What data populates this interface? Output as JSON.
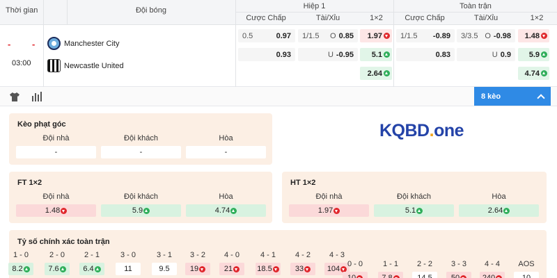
{
  "header": {
    "time": "Thời gian",
    "team": "Đội bóng",
    "half": "Hiệp 1",
    "full": "Toàn trận",
    "handicap": "Cược Chấp",
    "overunder": "Tài/Xỉu",
    "x12": "1×2"
  },
  "match": {
    "dash_left": "-",
    "dash_right": "-",
    "time": "03:00",
    "home": "Manchester City",
    "away": "Newcastle United",
    "half": {
      "hc_line": "0.5",
      "hc_home": "0.97",
      "hc_away": "0.93",
      "ou_line": "1/1.5",
      "ou_o_label": "O",
      "ou_o": "0.85",
      "ou_u_label": "U",
      "ou_u": "-0.95",
      "x12_home": "1.97",
      "x12_away": "5.1",
      "x12_draw": "2.64"
    },
    "full": {
      "hc_line": "1/1.5",
      "hc_home": "-0.89",
      "hc_away": "0.83",
      "ou_line": "3/3.5",
      "ou_o_label": "O",
      "ou_o": "-0.98",
      "ou_u_label": "U",
      "ou_u": "0.9",
      "x12_home": "1.48",
      "x12_away": "5.9",
      "x12_draw": "4.74"
    }
  },
  "toolbar": {
    "icons": [
      "shirt-icon",
      "stats-icon"
    ],
    "keo_label": "8 kèo"
  },
  "corner": {
    "title": "Kèo phạt góc",
    "home_label": "Đội nhà",
    "away_label": "Đội khách",
    "draw_label": "Hòa",
    "home": "-",
    "away": "-",
    "draw": "-"
  },
  "logo": {
    "part1": "KQBD",
    "dot": ".",
    "part2": "one"
  },
  "ft": {
    "title": "FT 1×2",
    "home_label": "Đội nhà",
    "away_label": "Đội khách",
    "draw_label": "Hòa",
    "home": "1.48",
    "away": "5.9",
    "draw": "4.74"
  },
  "ht": {
    "title": "HT 1×2",
    "home_label": "Đội nhà",
    "away_label": "Đội khách",
    "draw_label": "Hòa",
    "home": "1.97",
    "away": "5.1",
    "draw": "2.64"
  },
  "exact": {
    "title": "Tỷ số chính xác toàn trận",
    "row1": [
      {
        "score": "1 - 0",
        "odd": "8.2",
        "trend": "up"
      },
      {
        "score": "2 - 0",
        "odd": "7.6",
        "trend": "up"
      },
      {
        "score": "2 - 1",
        "odd": "6.4",
        "trend": "up"
      },
      {
        "score": "3 - 0",
        "odd": "11",
        "trend": "none"
      },
      {
        "score": "3 - 1",
        "odd": "9.5",
        "trend": "none"
      },
      {
        "score": "3 - 2",
        "odd": "19",
        "trend": "down"
      },
      {
        "score": "4 - 0",
        "odd": "21",
        "trend": "down"
      },
      {
        "score": "4 - 1",
        "odd": "18.5",
        "trend": "down"
      },
      {
        "score": "4 - 2",
        "odd": "33",
        "trend": "down"
      },
      {
        "score": "4 - 3",
        "odd": "104",
        "trend": "down"
      }
    ],
    "row2": [
      {
        "score": "0 - 0",
        "odd": "10",
        "trend": "down"
      },
      {
        "score": "1 - 1",
        "odd": "7.8",
        "trend": "down"
      },
      {
        "score": "2 - 2",
        "odd": "14.5",
        "trend": "none"
      },
      {
        "score": "3 - 3",
        "odd": "50",
        "trend": "down"
      },
      {
        "score": "4 - 4",
        "odd": "240",
        "trend": "down"
      },
      {
        "score": "AOS",
        "odd": "10",
        "trend": "none"
      }
    ]
  },
  "colors": {
    "accent_blue": "#2f8ae5",
    "up_green": "#2fae5a",
    "down_red": "#e0272c",
    "panel_bg": "#fcefe4"
  }
}
